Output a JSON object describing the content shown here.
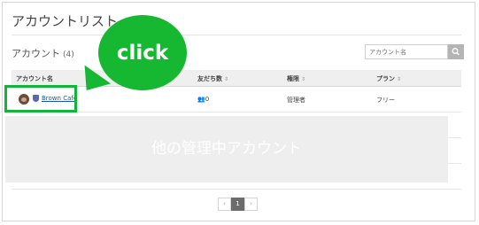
{
  "page_title": "アカウントリスト",
  "account_section": {
    "label": "アカウント",
    "count": "(4)"
  },
  "search": {
    "placeholder": "アカウント名"
  },
  "table": {
    "columns": [
      "アカウント名",
      "友だち数",
      "権限",
      "プラン"
    ],
    "rows": [
      {
        "name": "Brown Cafe",
        "friends": "0",
        "role": "管理者",
        "plan": "フリー"
      }
    ]
  },
  "callout": {
    "text": "click",
    "color": "#16b832"
  },
  "overlay_text": "他の管理中アカウント",
  "pagination": {
    "prev": "‹",
    "current": "1",
    "next": "›"
  }
}
